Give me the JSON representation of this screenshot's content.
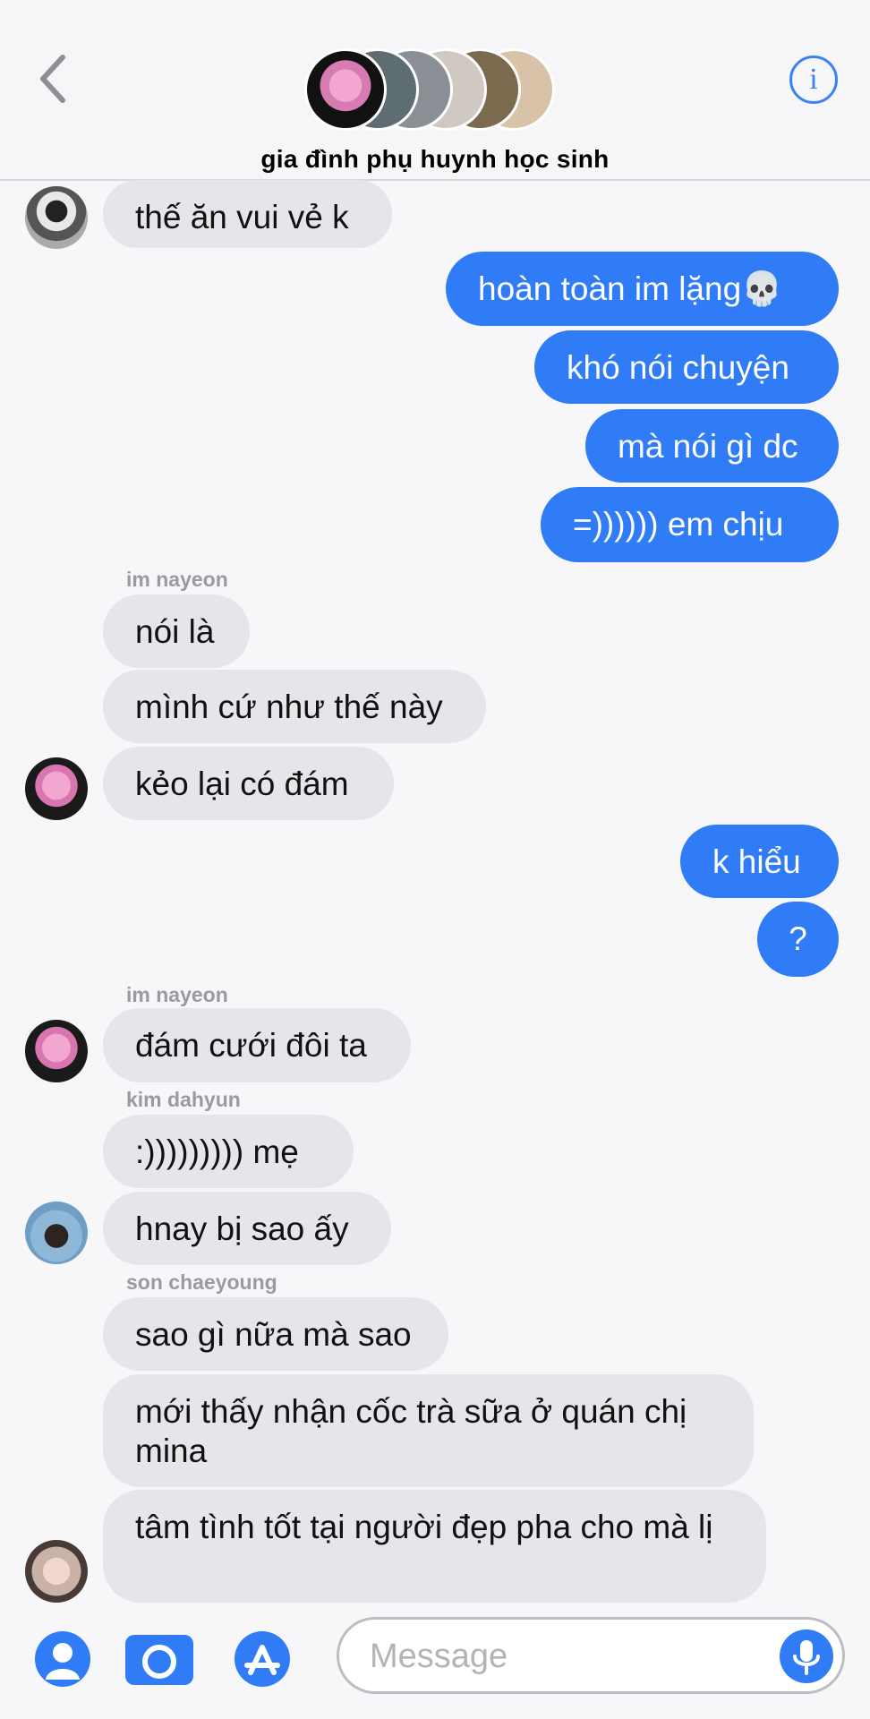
{
  "header": {
    "title": "gia đình phụ huynh học sinh",
    "back_icon": "chevron-left-icon",
    "info_icon": "info-icon",
    "info_glyph": "i"
  },
  "messages": [
    {
      "text": "thế ăn vui vẻ k",
      "direction": "incoming"
    },
    {
      "text": "hoàn toàn im lặng💀",
      "direction": "outgoing"
    },
    {
      "text": "khó nói chuyện",
      "direction": "outgoing"
    },
    {
      "text": "mà nói gì dc",
      "direction": "outgoing"
    },
    {
      "text": "=)))))) em chịu",
      "direction": "outgoing"
    },
    {
      "sender": "im nayeon"
    },
    {
      "text": "nói là",
      "direction": "incoming"
    },
    {
      "text": "mình cứ như thế này",
      "direction": "incoming"
    },
    {
      "text": "kẻo lại có đám",
      "direction": "incoming"
    },
    {
      "text": "k hiểu",
      "direction": "outgoing"
    },
    {
      "text": "?",
      "direction": "outgoing"
    },
    {
      "sender": "im nayeon"
    },
    {
      "text": "đám cưới đôi ta",
      "direction": "incoming"
    },
    {
      "sender": "kim dahyun"
    },
    {
      "text": ":))))))))) mẹ",
      "direction": "incoming"
    },
    {
      "text": "hnay bị sao ấy",
      "direction": "incoming"
    },
    {
      "sender": "son chaeyoung"
    },
    {
      "text": "sao gì nữa mà sao",
      "direction": "incoming"
    },
    {
      "text": "mới thấy nhận cốc trà sữa ở quán chị mina",
      "direction": "incoming"
    },
    {
      "text": "tâm tình tốt tại người đẹp pha cho mà lị",
      "direction": "incoming"
    }
  ],
  "composer": {
    "placeholder": "Message",
    "icons": [
      "memoji-icon",
      "camera-icon",
      "app-store-icon",
      "microphone-icon"
    ]
  },
  "colors": {
    "outgoing_bubble": "#2f7cf6",
    "incoming_bubble": "#e5e5ea",
    "accent": "#3b82f6"
  }
}
